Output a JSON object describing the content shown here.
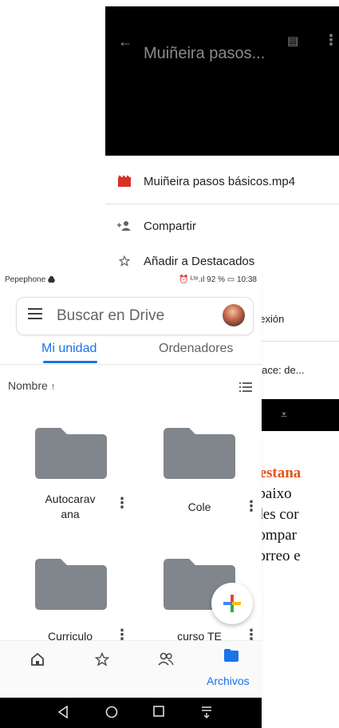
{
  "background": {
    "video_title": "Muiñeira pasos...",
    "file_name": "Muiñeira pasos básicos.mp4",
    "share_label": "Compartir",
    "star_label": "Añadir a Destacados",
    "partial_offline": "nexión",
    "partial_link": "nlace: de...",
    "text_lines": [
      "pestana",
      "abaixo",
      "ides cor",
      "compar",
      "correo e"
    ]
  },
  "status_bar": {
    "carrier": "Pepephone",
    "right": "⏰ ᴸᵗᵉ.ıl 92 % ▭ 10:38"
  },
  "search": {
    "placeholder": "Buscar en Drive"
  },
  "tabs": [
    {
      "label": "Mi unidad",
      "active": true
    },
    {
      "label": "Ordenadores",
      "active": false
    }
  ],
  "sort": {
    "label": "Nombre",
    "direction": "↑"
  },
  "folders": [
    {
      "name_line1": "Autocarav",
      "name_line2": "ana"
    },
    {
      "name_line1": "Cole",
      "name_line2": ""
    },
    {
      "name_line1": "Curriculo",
      "name_line2": ""
    },
    {
      "name_line1": "curso TE",
      "name_line2": ""
    }
  ],
  "bottom_nav": {
    "items": [
      "home-icon",
      "star-icon",
      "people-icon",
      "folder-icon"
    ],
    "active_label": "Archivos"
  },
  "colors": {
    "accent": "#1a73e8",
    "folder": "#80868b",
    "orange": "#e8511b"
  }
}
